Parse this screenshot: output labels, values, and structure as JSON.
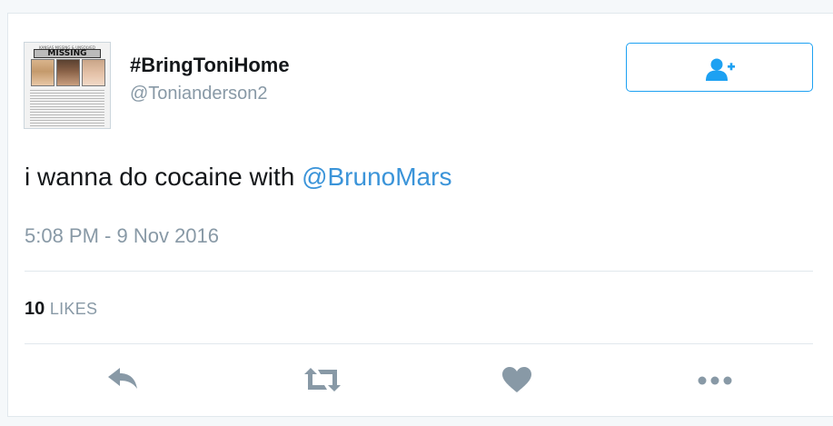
{
  "profile": {
    "display_name": "#BringToniHome",
    "handle": "@Tonianderson2",
    "avatar": {
      "header_text": "KANSAS MISSING & UNSOLVED",
      "title_text": "MISSING"
    }
  },
  "follow_button": {
    "icon": "follow-user-icon",
    "color": "#1da1f2"
  },
  "tweet": {
    "text_before": "i wanna do cocaine with ",
    "mention": "@BrunoMars",
    "timestamp": "5:08 PM - 9 Nov 2016"
  },
  "stats": {
    "likes_count": "10",
    "likes_label": "LIKES"
  },
  "actions": [
    {
      "name": "reply",
      "icon": "reply-icon"
    },
    {
      "name": "retweet",
      "icon": "retweet-icon"
    },
    {
      "name": "like",
      "icon": "heart-icon"
    },
    {
      "name": "more",
      "icon": "more-icon"
    }
  ],
  "colors": {
    "accent": "#1da1f2",
    "mention": "#3b94d9",
    "muted": "#8899a6",
    "icon": "#8899a6"
  }
}
